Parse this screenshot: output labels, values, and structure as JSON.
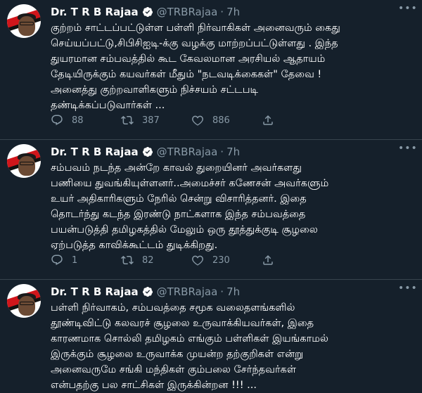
{
  "tweets": [
    {
      "name": "Dr. T R B Rajaa",
      "handle": "@TRBRajaa",
      "time": "7h",
      "text": "குற்றம் சாட்டப்பட்டுள்ள பள்ளி நிர்வாகிகள் அனைவரும் கைது\nசெய்யப்பட்டு,சிபிசிஐடி-க்கு வழக்கு மாற்றப்பட்டுள்ளது . இந்த\nதுயரமான சம்பவத்தில் கூட கேவலமான அரசியல் ஆதாயம்\nதேடியிருக்கும் கயவர்கள் மீதும் \"நடவடிக்கைகள்\" தேவை !\nஅனைத்து குற்றவாளிகளும் நிச்சயம் சட்டபடி\nதண்டிக்கப்படுவார்கள் ...",
      "replies": "88",
      "retweets": "387",
      "likes": "886"
    },
    {
      "name": "Dr. T R B Rajaa",
      "handle": "@TRBRajaa",
      "time": "7h",
      "text": "சம்பவம் நடந்த அன்றே காவல் துறையினர் அவர்களது\nபணியை துவங்கியுள்ளனர்..அமைச்சர் கணேசன் அவர்களும்\nஉயர் அதிகாரிகளும் நேரில் சென்று விசாரித்தனர். இதை\nதொடர்ந்து கடந்த இரண்டு நாட்களாக இந்த சம்பவத்தை\nபயன்படுத்தி தமிழகத்தில் மேலும் ஒரு தூத்துக்குடி சூழலை\nஏற்படுத்த காவிக்கூட்டம் துடிக்கிறது.",
      "replies": "1",
      "retweets": "82",
      "likes": "230"
    },
    {
      "name": "Dr. T R B Rajaa",
      "handle": "@TRBRajaa",
      "time": "7h",
      "text": "பள்ளி நிர்வாகம், சம்பவத்தை சமூக வலைதளங்களில்\nதூண்டிவிட்டு கலவரச் சூழலை உருவாக்கியவர்கள், இதை\nகாரணமாக சொல்லி தமிழகம் எங்கும் பள்ளிகள் இயங்காமல்\nஇருக்கும் சூழலை உருவாக்க முயன்ற தற்குறிகள் என்று\nஅனைவருமே சங்கி மந்திகள் கும்பலை சேர்ந்தவர்கள்\nஎன்பதற்கு பல சாட்சிகள் இருக்கின்றன !!! ..."
    }
  ],
  "colors": {
    "background": "#15202b",
    "muted": "#8899a6",
    "verified": "#1d9bf0",
    "divider": "#38444d"
  }
}
